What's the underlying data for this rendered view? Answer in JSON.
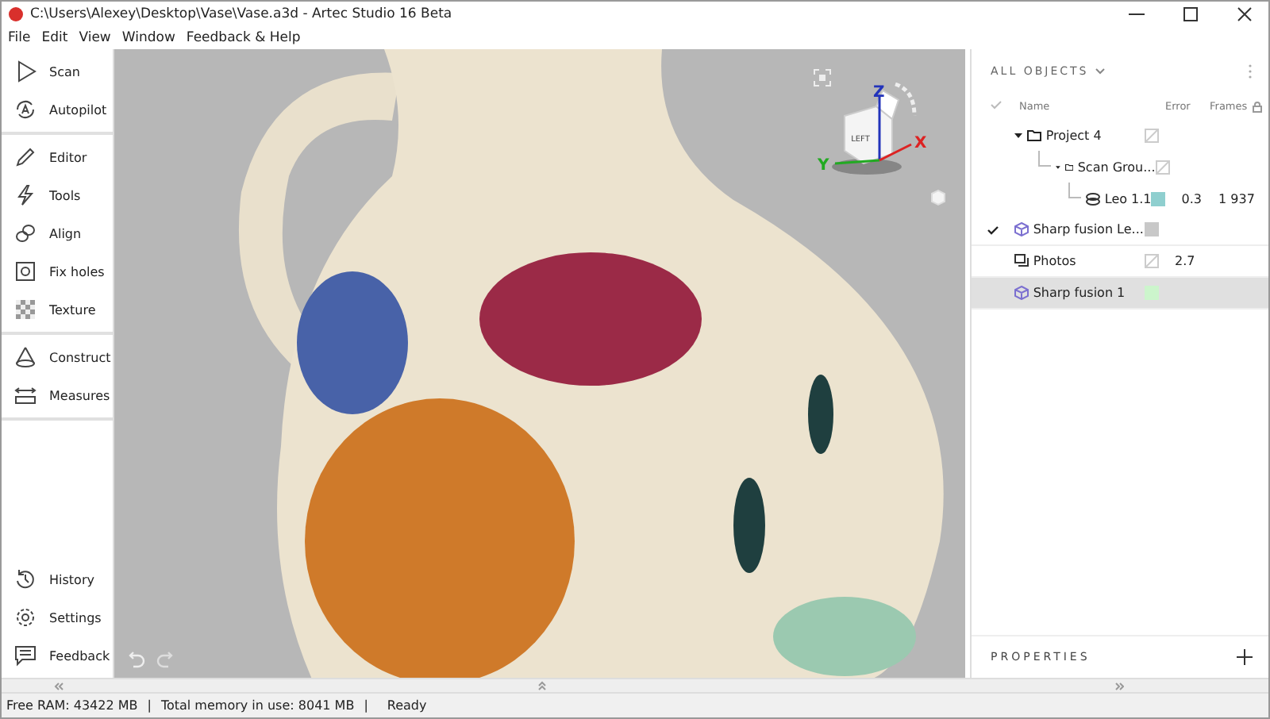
{
  "window": {
    "title": "C:\\Users\\Alexey\\Desktop\\Vase\\Vase.a3d - Artec Studio 16 Beta"
  },
  "menu": [
    "File",
    "Edit",
    "View",
    "Window",
    "Feedback & Help"
  ],
  "sidebar": {
    "groups": [
      [
        {
          "label": "Scan",
          "kind": "scan"
        },
        {
          "label": "Autopilot",
          "kind": "autopilot"
        }
      ],
      [
        {
          "label": "Editor",
          "kind": "editor"
        },
        {
          "label": "Tools",
          "kind": "tools"
        },
        {
          "label": "Align",
          "kind": "align"
        },
        {
          "label": "Fix holes",
          "kind": "fixholes"
        },
        {
          "label": "Texture",
          "kind": "texture"
        }
      ],
      [
        {
          "label": "Construct",
          "kind": "construct"
        },
        {
          "label": "Measures",
          "kind": "measures"
        }
      ]
    ],
    "bottom": [
      {
        "label": "History",
        "kind": "history"
      },
      {
        "label": "Settings",
        "kind": "settings"
      },
      {
        "label": "Feedback",
        "kind": "feedback"
      }
    ]
  },
  "viewport": {
    "nav_cube": {
      "face": "LEFT",
      "axes": [
        "Z",
        "Y",
        "X"
      ]
    }
  },
  "objects": {
    "title": "ALL OBJECTS",
    "columns": [
      "Name",
      "Error",
      "Frames"
    ],
    "rows": [
      {
        "name": "Project 4",
        "kind": "folder",
        "checked": false,
        "selected": false,
        "expanded": true,
        "children": [
          {
            "name": "Scan Grou...",
            "kind": "folder",
            "checked": false,
            "selected": false,
            "expanded": true,
            "children": [
              {
                "name": "Leo 1.1",
                "kind": "scan",
                "checked": false,
                "selected": false,
                "color": "#8fcfcf",
                "error": "0.3",
                "frames": "1 937"
              }
            ]
          }
        ]
      },
      {
        "name": "Sharp fusion Le...",
        "kind": "fusion",
        "checked": true,
        "selected": false,
        "color": "#c8c8c8"
      },
      {
        "name": "Photos",
        "kind": "photos",
        "checked": false,
        "selected": false,
        "error": "2.7"
      },
      {
        "name": "Sharp fusion 1",
        "kind": "fusion",
        "checked": false,
        "selected": true,
        "color": "#ccf5cc"
      }
    ]
  },
  "properties": {
    "title": "PROPERTIES"
  },
  "status_bar": [
    "Free RAM: 43422 MB",
    "|",
    "Total memory in use: 8041 MB",
    "|",
    "Ready"
  ]
}
